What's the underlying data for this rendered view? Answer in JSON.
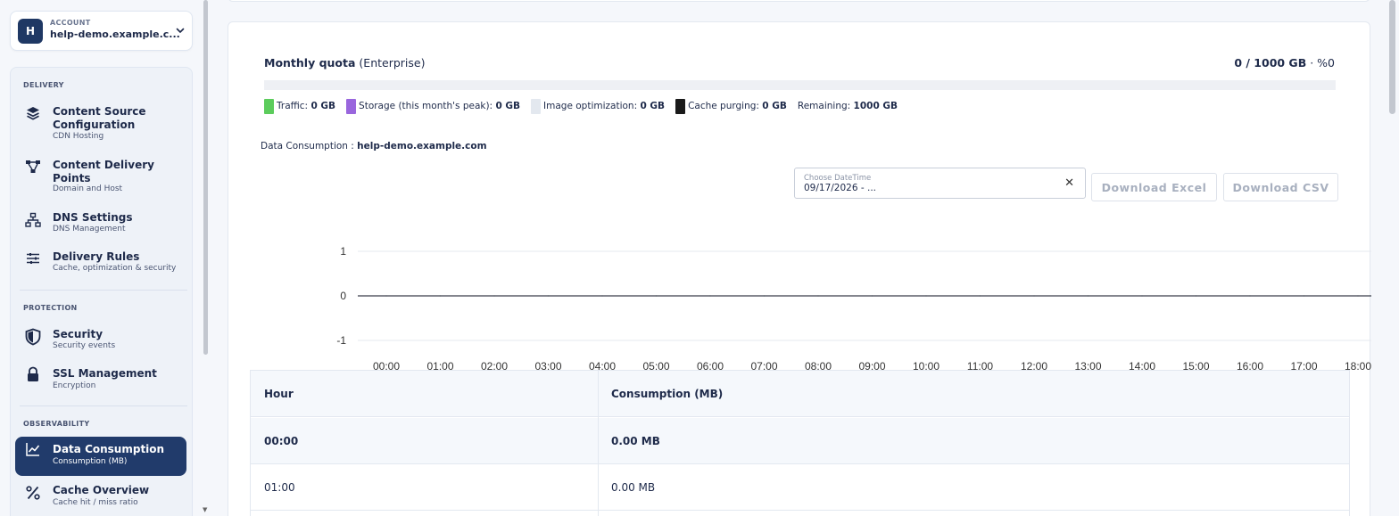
{
  "account": {
    "avatar_letter": "H",
    "label": "ACCOUNT",
    "name": "help-demo.example.c..."
  },
  "sidebar": {
    "sections": [
      {
        "label": "DELIVERY",
        "items": [
          {
            "icon": "layers-icon",
            "title": "Content Source Configuration",
            "subtitle": "CDN Hosting"
          },
          {
            "icon": "network-icon",
            "title": "Content Delivery Points",
            "subtitle": "Domain and Host"
          },
          {
            "icon": "sitemap-icon",
            "title": "DNS Settings",
            "subtitle": "DNS Management"
          },
          {
            "icon": "sliders-icon",
            "title": "Delivery Rules",
            "subtitle": "Cache, optimization & security"
          }
        ]
      },
      {
        "label": "PROTECTION",
        "items": [
          {
            "icon": "shield-icon",
            "title": "Security",
            "subtitle": "Security events"
          },
          {
            "icon": "lock-icon",
            "title": "SSL Management",
            "subtitle": "Encryption"
          }
        ]
      },
      {
        "label": "OBSERVABILITY",
        "items": [
          {
            "icon": "chart-line-icon",
            "title": "Data Consumption",
            "subtitle": "Consumption (MB)",
            "active": true
          },
          {
            "icon": "percent-icon",
            "title": "Cache Overview",
            "subtitle": "Cache hit / miss ratio"
          }
        ]
      }
    ]
  },
  "quota": {
    "title": "Monthly quota",
    "plan": "(Enterprise)",
    "usage": "0 / 1000 GB",
    "percent": "· %0",
    "fill_percent": 0
  },
  "legend": [
    {
      "label": "Traffic:",
      "value": "0 GB",
      "color": "#5ccc5c"
    },
    {
      "label": "Storage (this month's peak):",
      "value": "0 GB",
      "color": "#9966dd"
    },
    {
      "label": "Image optimization:",
      "value": "0 GB",
      "color": "#e3e8ef"
    },
    {
      "label": "Cache purging:",
      "value": "0 GB",
      "color": "#1a1a1a"
    },
    {
      "label": "Remaining:",
      "value": "1000 GB"
    }
  ],
  "consumption": {
    "label": "Data Consumption :",
    "domain": "help-demo.example.com"
  },
  "date_picker": {
    "label": "Choose DateTime",
    "value": "09/17/2026 - ...",
    "clear": "✕"
  },
  "buttons": {
    "download_excel": "Download Excel",
    "download_csv": "Download CSV"
  },
  "chart_data": {
    "type": "line",
    "x": [
      "00:00",
      "01:00",
      "02:00",
      "03:00",
      "04:00",
      "05:00",
      "06:00",
      "07:00",
      "08:00",
      "09:00",
      "10:00",
      "11:00",
      "12:00",
      "13:00",
      "14:00",
      "15:00",
      "16:00",
      "17:00",
      "18:00"
    ],
    "series": [
      {
        "values": [
          0,
          0,
          0,
          0,
          0,
          0,
          0,
          0,
          0,
          0,
          0,
          0,
          0,
          0,
          0,
          0,
          0,
          0,
          0
        ]
      }
    ],
    "yticks": [
      "1",
      "0",
      "-1"
    ],
    "ylim": [
      -1,
      1
    ],
    "grid": true
  },
  "table": {
    "headers": [
      "Hour",
      "Consumption (MB)"
    ],
    "rows": [
      [
        "00:00",
        "0.00 MB"
      ],
      [
        "01:00",
        "0.00 MB"
      ]
    ]
  }
}
